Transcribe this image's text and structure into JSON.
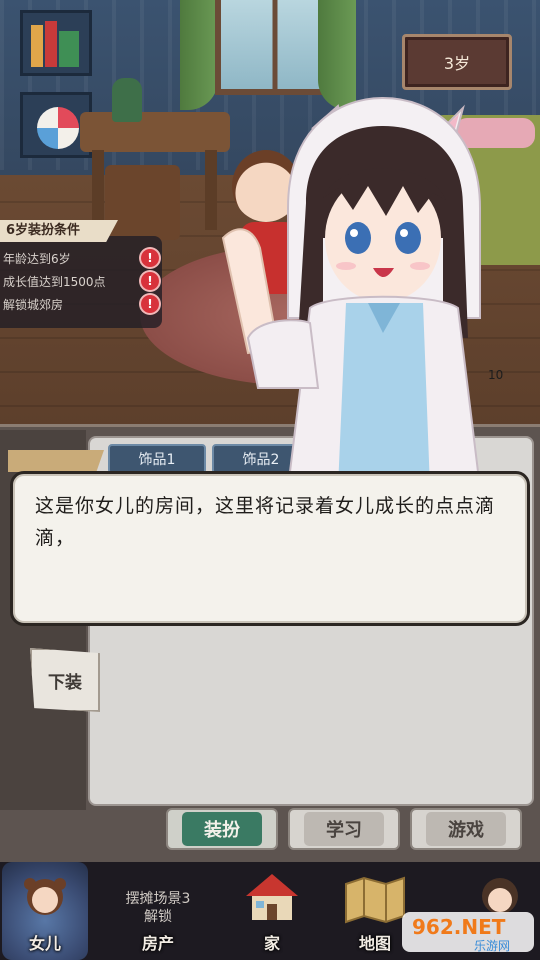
{
  "age_badge": "3岁",
  "conditions": {
    "title": "6岁装扮条件",
    "items": [
      {
        "text": "年龄达到6岁"
      },
      {
        "text": "成长值达到1500点"
      },
      {
        "text": "解锁城郊房"
      }
    ],
    "warn_symbol": "!"
  },
  "side_tag": "10",
  "accessory_tabs": [
    "饰品1",
    "饰品2"
  ],
  "dialog": {
    "text": "这是你女儿的房间，这里将记录着女儿成长的点点滴滴，"
  },
  "unequip_label": "下装",
  "category_tabs": {
    "dress_up": "装扮",
    "study": "学习",
    "games": "游戏"
  },
  "bottom_nav": {
    "daughter": "女儿",
    "property_lock": "摆摊场景3\n解锁",
    "property": "房产",
    "home": "家",
    "map": "地图"
  },
  "watermark": {
    "brand": "962.NET",
    "site": "乐游网"
  },
  "colors": {
    "active_tab": "#3a7a63",
    "warn": "#d8323b"
  }
}
